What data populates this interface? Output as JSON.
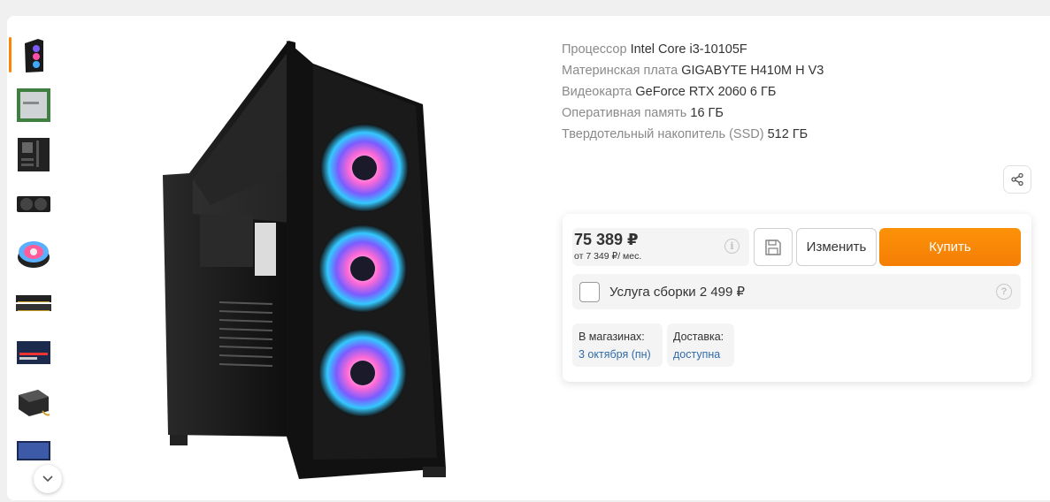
{
  "thumbnails": [
    {
      "icon": "pc-case-thumb-icon"
    },
    {
      "icon": "cpu-thumb-icon"
    },
    {
      "icon": "motherboard-thumb-icon"
    },
    {
      "icon": "gpu-thumb-icon"
    },
    {
      "icon": "cooler-thumb-icon"
    },
    {
      "icon": "ram-thumb-icon"
    },
    {
      "icon": "ssd-thumb-icon"
    },
    {
      "icon": "psu-thumb-icon"
    },
    {
      "icon": "monitor-thumb-icon"
    }
  ],
  "specs": [
    {
      "label": "Процессор",
      "value": "Intel Core i3-10105F"
    },
    {
      "label": "Материнская плата",
      "value": "GIGABYTE H410M H V3"
    },
    {
      "label": "Видеокарта",
      "value": "GeForce RTX 2060 6 ГБ"
    },
    {
      "label": "Оперативная память",
      "value": "16 ГБ"
    },
    {
      "label": "Твердотельный накопитель (SSD)",
      "value": "512 ГБ"
    }
  ],
  "buy": {
    "price": "75 389 ₽",
    "credit": "от 7 349 ₽/ мес.",
    "edit_label": "Изменить",
    "buy_label": "Купить",
    "assembly_label": "Услуга сборки 2 499 ₽",
    "stores_title": "В магазинах:",
    "stores_value": "3 октября (пн)",
    "delivery_title": "Доставка:",
    "delivery_value": "доступна"
  },
  "colors": {
    "accent": "#fc8507",
    "link": "#2f6ba8"
  }
}
